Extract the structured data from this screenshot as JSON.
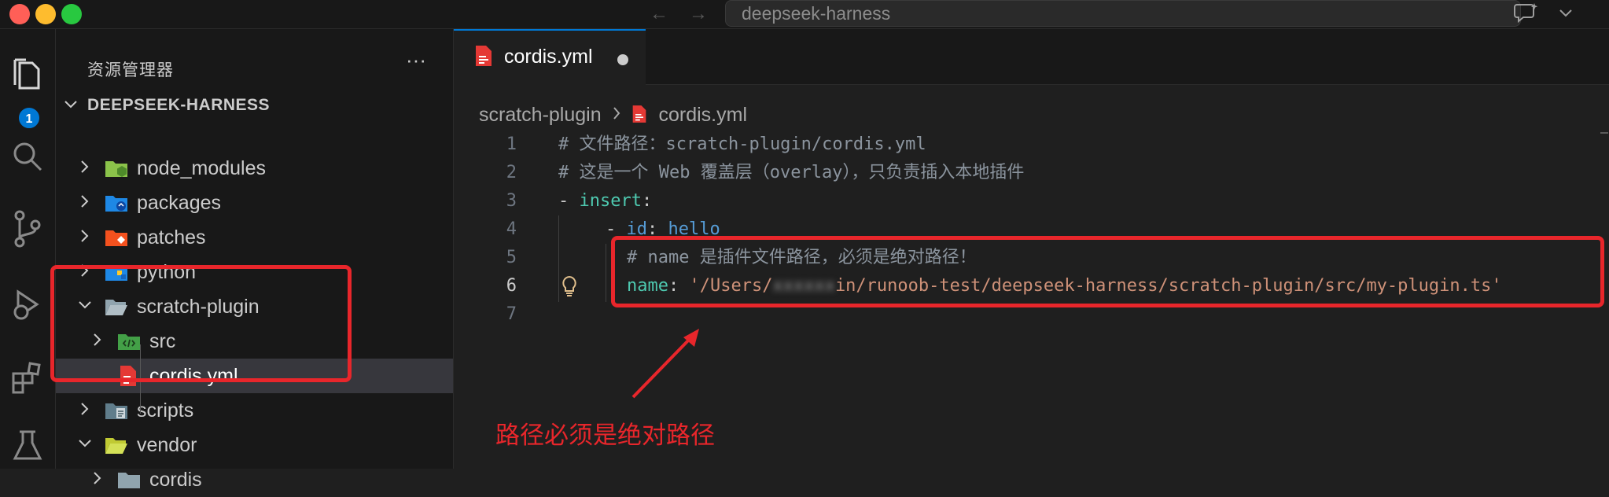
{
  "window": {
    "search_text": "deepseek-harness",
    "traffic_lights": [
      "#ff5f57",
      "#febc2e",
      "#28c840"
    ]
  },
  "activity_bar": {
    "explorer_badge": "1",
    "items": [
      "files-icon",
      "search-icon",
      "source-control-icon",
      "run-debug-icon",
      "extensions-icon",
      "testing-icon"
    ]
  },
  "explorer": {
    "title": "资源管理器",
    "more_label": "···",
    "root": "DEEPSEEK-HARNESS",
    "items": [
      {
        "label": "node_modules",
        "expanded": false
      },
      {
        "label": "packages",
        "expanded": false
      },
      {
        "label": "patches",
        "expanded": false
      },
      {
        "label": "python",
        "expanded": false
      },
      {
        "label": "scratch-plugin",
        "expanded": true
      },
      {
        "label": "src",
        "expanded": false
      },
      {
        "label": "cordis.yml",
        "selected": true
      },
      {
        "label": "scripts",
        "expanded": false
      },
      {
        "label": "vendor",
        "expanded": true
      },
      {
        "label": "cordis",
        "expanded": false
      }
    ]
  },
  "editor": {
    "tab_label": "cordis.yml",
    "breadcrumb": {
      "folder": "scratch-plugin",
      "file": "cordis.yml"
    },
    "line_numbers": [
      "1",
      "2",
      "3",
      "4",
      "5",
      "6",
      "7"
    ],
    "lines": {
      "l1": "# 文件路径：scratch-plugin/cordis.yml",
      "l2": "# 这是一个 Web 覆盖层（overlay），只负责插入本地插件",
      "l3_dash": "- ",
      "l3_key": "insert",
      "l3_colon": ":",
      "l4_dash": "- ",
      "l4_key": "id",
      "l4_colon": ": ",
      "l4_val": "hello",
      "l5": "# name 是插件文件路径，必须是绝对路径！",
      "l6_key": "name",
      "l6_colon": ": ",
      "l6_str_a": "'/Users/",
      "l6_str_blur": "xxxxxx",
      "l6_str_b": "in/runoob-test/deepseek-harness/scratch-plugin/src/my-plugin.ts'"
    }
  },
  "annotation": {
    "text": "路径必须是绝对路径",
    "color": "#e8262b"
  }
}
